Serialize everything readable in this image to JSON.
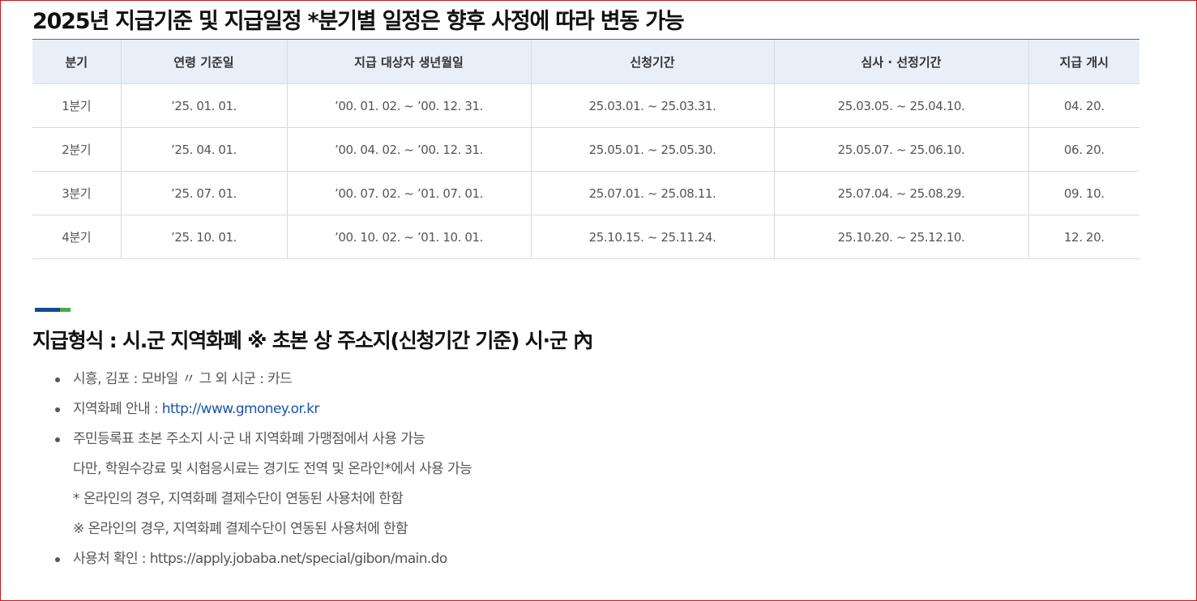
{
  "schedule": {
    "title": "2025년 지급기준 및 지급일정 *분기별 일정은 향후 사정에 따라 변동 가능",
    "headers": [
      "분기",
      "연령 기준일",
      "지급 대상자 생년월일",
      "신청기간",
      "심사 · 선정기간",
      "지급 개시"
    ],
    "rows": [
      [
        "1분기",
        "’25. 01. 01.",
        "’00. 01. 02. ~ ’00. 12. 31.",
        "25.03.01. ~ 25.03.31.",
        "25.03.05. ~ 25.04.10.",
        "04. 20."
      ],
      [
        "2분기",
        "’25. 04. 01.",
        "’00. 04. 02. ~ ’00. 12. 31.",
        "25.05.01. ~ 25.05.30.",
        "25.05.07. ~ 25.06.10.",
        "06. 20."
      ],
      [
        "3분기",
        "’25. 07. 01.",
        "’00. 07. 02. ~ ’01. 07. 01.",
        "25.07.01. ~ 25.08.11.",
        "25.07.04. ~ 25.08.29.",
        "09. 10."
      ],
      [
        "4분기",
        "’25. 10. 01.",
        "’00. 10. 02. ~ ’01. 10. 01.",
        "25.10.15. ~ 25.11.24.",
        "25.10.20. ~ 25.12.10.",
        "12. 20."
      ]
    ]
  },
  "payment_form": {
    "title": "지급형식 : 시.군 지역화폐 ※ 초본 상 주소지(신청기간 기준) 시·군 內",
    "items": [
      {
        "text": "시흥, 김포 : 모바일 〃 그 외 시군 : 카드"
      },
      {
        "prefix": "지역화폐 안내 : ",
        "link": "http://www.gmoney.or.kr"
      },
      {
        "lines": [
          "주민등록표 초본 주소지 시·군 내 지역화폐 가맹점에서 사용 가능",
          "다만, 학원수강료 및 시험응시료는 경기도 전역 및 온라인*에서 사용 가능",
          "* 온라인의 경우, 지역화폐 결제수단이 연동된 사용처에 한함",
          "※ 온라인의 경우, 지역화폐 결제수단이 연동된 사용처에 한함"
        ]
      },
      {
        "text": "사용처 확인 : https://apply.jobaba.net/special/gibon/main.do"
      }
    ]
  },
  "colors": {
    "header_bg": "#e8eff7",
    "accent_blue": "#144b94",
    "accent_green": "#4ca94b",
    "link": "#1a54a6",
    "frame": "#c8171e"
  }
}
